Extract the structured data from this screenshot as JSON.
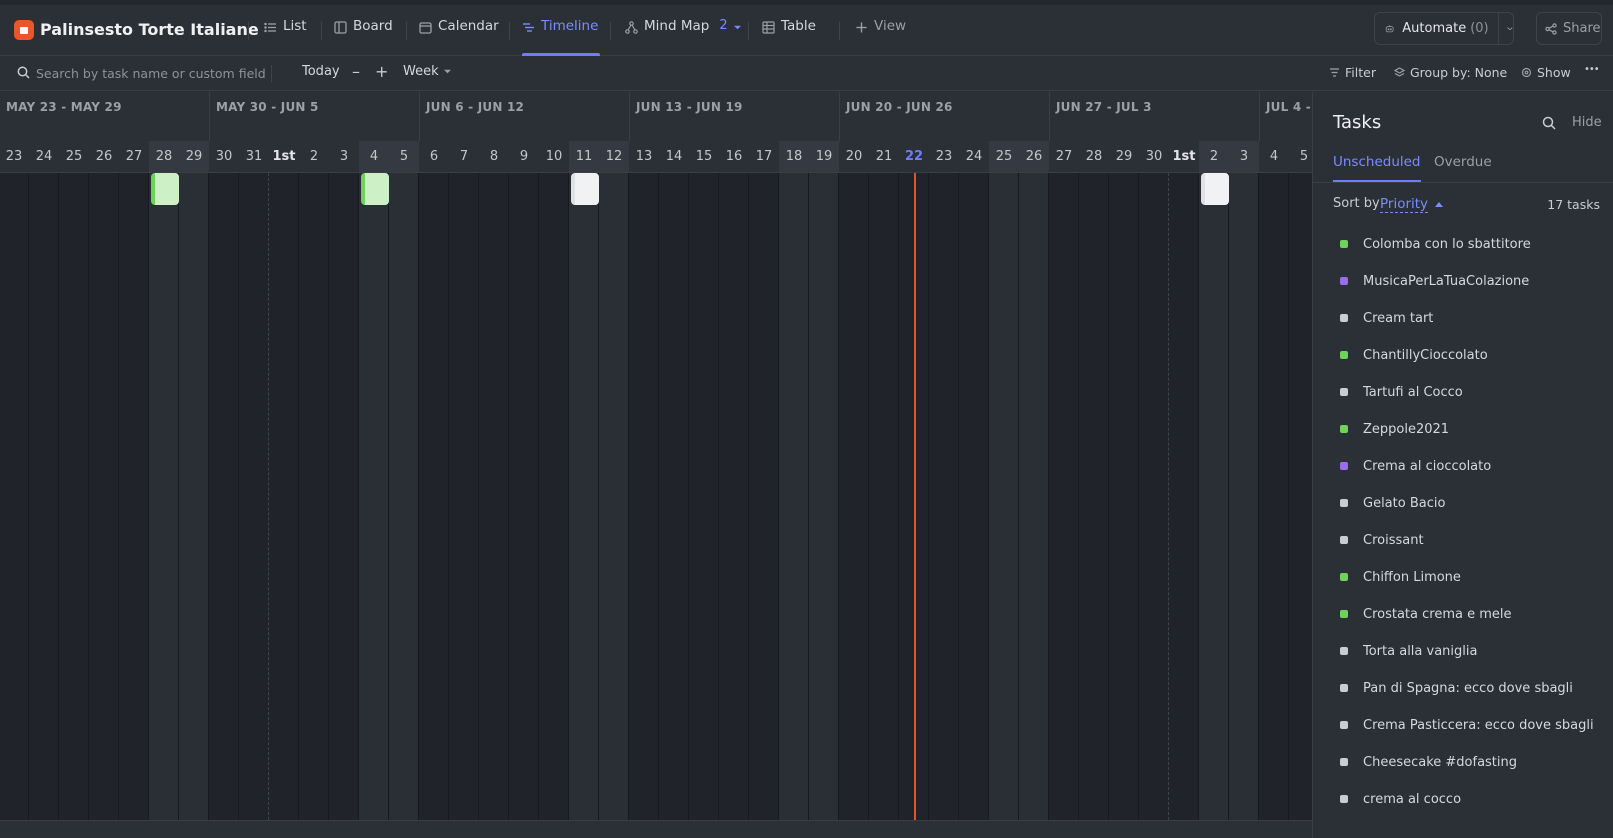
{
  "app": {
    "title": "Palinsesto Torte Italiane"
  },
  "views": [
    {
      "label": "List",
      "icon": "list-icon",
      "active": false
    },
    {
      "label": "Board",
      "icon": "board-icon",
      "active": false
    },
    {
      "label": "Calendar",
      "icon": "calendar-icon",
      "active": false
    },
    {
      "label": "Timeline",
      "icon": "timeline-icon",
      "active": true
    },
    {
      "label": "Mind Map",
      "icon": "mind-map-icon",
      "active": false,
      "badge": "2"
    },
    {
      "label": "Table",
      "icon": "table-icon",
      "active": false
    }
  ],
  "add_view_label": "View",
  "automate": {
    "label": "Automate",
    "count": "(0)"
  },
  "share_label": "Share",
  "toolbar": {
    "search_placeholder": "Search by task name or custom field...",
    "today_label": "Today",
    "zoom_out_label": "–",
    "zoom_in_label": "+",
    "scale_label": "Week",
    "filter_label": "Filter",
    "group_label": "Group by: None",
    "show_label": "Show",
    "more_label": "•••"
  },
  "timeline": {
    "weeks": [
      "MAY 23 - MAY 29",
      "MAY 30 - JUN 5",
      "JUN 6 - JUN 12",
      "JUN 13 - JUN 19",
      "JUN 20 - JUN 26",
      "JUN 27 - JUL 3",
      "JUL 4 -"
    ],
    "days": [
      "23",
      "24",
      "25",
      "26",
      "27",
      "28",
      "29",
      "30",
      "31",
      "1st",
      "2",
      "3",
      "4",
      "5",
      "6",
      "7",
      "8",
      "9",
      "10",
      "11",
      "12",
      "13",
      "14",
      "15",
      "16",
      "17",
      "18",
      "19",
      "20",
      "21",
      "22",
      "23",
      "24",
      "25",
      "26",
      "27",
      "28",
      "29",
      "30",
      "1st",
      "2",
      "3",
      "4",
      "5"
    ],
    "weekend_days": [
      5,
      6,
      12,
      13,
      19,
      20,
      26,
      27,
      33,
      34,
      40,
      41
    ],
    "month_start_days": [
      9,
      39
    ],
    "today_index": 30,
    "task_bars": [
      {
        "day_index": 5,
        "color": "green"
      },
      {
        "day_index": 12,
        "color": "green"
      },
      {
        "day_index": 19,
        "color": "white"
      },
      {
        "day_index": 40,
        "color": "white"
      }
    ],
    "colors": {
      "today_line": "#e8502e",
      "accent": "#7b8cff",
      "green": "#6fd35a",
      "purple": "#9a6cf0",
      "gray": "#c9cdd2"
    }
  },
  "tasks_panel": {
    "title": "Tasks",
    "hide_label": "Hide",
    "tabs": [
      {
        "label": "Unscheduled",
        "active": true
      },
      {
        "label": "Overdue",
        "active": false
      }
    ],
    "sort_label": "Sort by",
    "sort_value": "Priority",
    "count_label": "17 tasks",
    "tasks": [
      {
        "name": "Colomba con lo sbattitore",
        "status_color": "#6fd35a"
      },
      {
        "name": "MusicaPerLaTuaColazione",
        "status_color": "#9a6cf0"
      },
      {
        "name": "Cream tart",
        "status_color": "#c9cdd2"
      },
      {
        "name": "ChantillyCioccolato",
        "status_color": "#6fd35a"
      },
      {
        "name": "Tartufi al Cocco",
        "status_color": "#c9cdd2"
      },
      {
        "name": "Zeppole2021",
        "status_color": "#6fd35a"
      },
      {
        "name": "Crema al cioccolato",
        "status_color": "#9a6cf0"
      },
      {
        "name": "Gelato Bacio",
        "status_color": "#c9cdd2"
      },
      {
        "name": "Croissant",
        "status_color": "#c9cdd2"
      },
      {
        "name": "Chiffon Limone",
        "status_color": "#6fd35a"
      },
      {
        "name": "Crostata crema e mele",
        "status_color": "#6fd35a"
      },
      {
        "name": "Torta alla vaniglia",
        "status_color": "#c9cdd2"
      },
      {
        "name": "Pan di Spagna: ecco dove sbagli",
        "status_color": "#c9cdd2"
      },
      {
        "name": "Crema Pasticcera: ecco dove sbagli",
        "status_color": "#c9cdd2"
      },
      {
        "name": "Cheesecake #dofasting",
        "status_color": "#c9cdd2"
      },
      {
        "name": "crema al cocco",
        "status_color": "#c9cdd2"
      }
    ]
  }
}
